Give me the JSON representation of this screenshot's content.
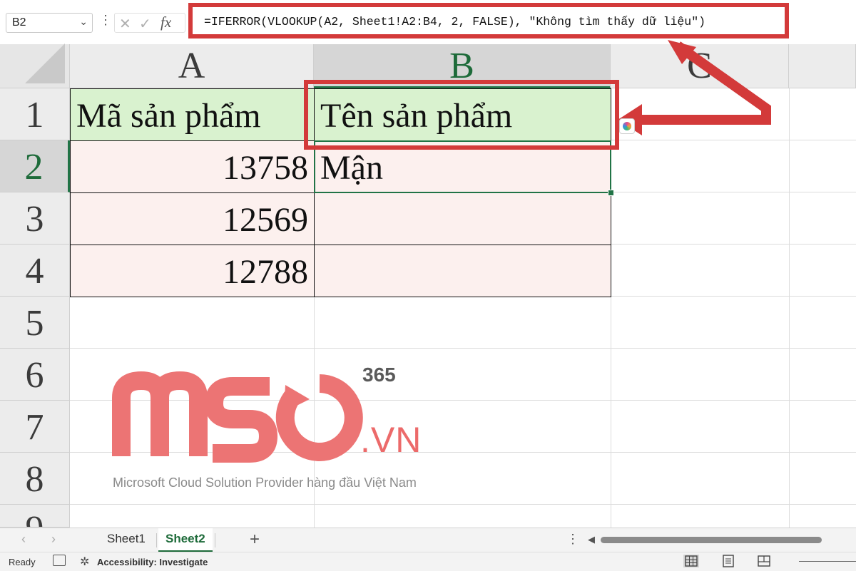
{
  "formula_bar": {
    "name_box": "B2",
    "formula": "=IFERROR(VLOOKUP(A2, Sheet1!A2:B4, 2, FALSE), \"Không tìm thấy dữ liệu\")"
  },
  "columns": [
    "A",
    "B",
    "C"
  ],
  "rows": [
    "1",
    "2",
    "3",
    "4",
    "5",
    "6",
    "7",
    "8",
    "9"
  ],
  "table": {
    "headers": [
      "Mã sản phẩm",
      "Tên sản phẩm"
    ],
    "rows": [
      [
        "13758",
        "Mận"
      ],
      [
        "12569",
        ""
      ],
      [
        "12788",
        ""
      ]
    ]
  },
  "watermark": {
    "logo": "MSO",
    "badge": "365",
    "domain": ".VN",
    "tagline": "Microsoft Cloud Solution Provider hàng đầu Việt Nam"
  },
  "sheets": {
    "tabs": [
      "Sheet1",
      "Sheet2"
    ],
    "active": "Sheet2"
  },
  "status": {
    "ready": "Ready",
    "accessibility": "Accessibility: Investigate"
  },
  "colors": {
    "accent_green": "#217346",
    "callout_red": "#d33a3a",
    "header_fill": "#d9f2cf",
    "body_fill": "#fcf0ee"
  }
}
